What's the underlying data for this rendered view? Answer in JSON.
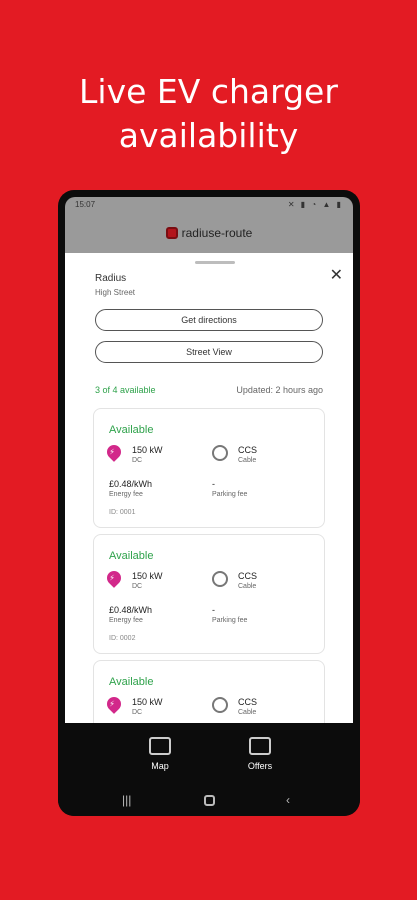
{
  "headline": {
    "line1": "Live EV charger",
    "line2": "availability"
  },
  "statusbar": {
    "time": "15:07",
    "icons": "✕ ▮ ◔ ▲ ▮"
  },
  "app": {
    "name": "radiuse-route"
  },
  "sheet": {
    "place_name": "Radius",
    "street": "High Street",
    "directions_label": "Get directions",
    "streetview_label": "Street View",
    "availability": "3 of 4 available",
    "updated": "Updated: 2 hours ago"
  },
  "chargers": [
    {
      "status": "Available",
      "power": "150 kW",
      "current": "DC",
      "connector": "CCS",
      "connector_type": "Cable",
      "energy_fee": "£0.48/kWh",
      "energy_fee_label": "Energy fee",
      "parking_fee": "-",
      "parking_fee_label": "Parking fee",
      "id": "ID: 0001"
    },
    {
      "status": "Available",
      "power": "150 kW",
      "current": "DC",
      "connector": "CCS",
      "connector_type": "Cable",
      "energy_fee": "£0.48/kWh",
      "energy_fee_label": "Energy fee",
      "parking_fee": "-",
      "parking_fee_label": "Parking fee",
      "id": "ID: 0002"
    },
    {
      "status": "Available",
      "power": "150 kW",
      "current": "DC",
      "connector": "CCS",
      "connector_type": "Cable"
    }
  ],
  "bottomnav": [
    {
      "label": "Map",
      "icon": "map-icon"
    },
    {
      "label": "Offers",
      "icon": "offers-icon"
    }
  ],
  "colors": {
    "brand": "#e31b23",
    "available": "#2fa24b",
    "pin": "#d2288a"
  }
}
